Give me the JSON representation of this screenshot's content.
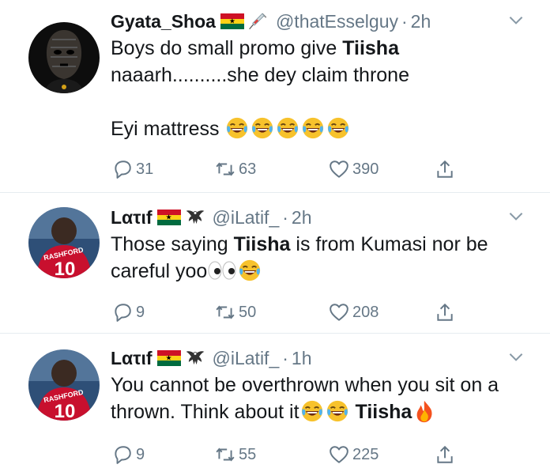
{
  "tweets": [
    {
      "display_name": "Gyata_Shoa",
      "handle": "@thatEsselguy",
      "time": "2h",
      "text_a": "Boys do small promo give ",
      "text_bold": "Tiisha",
      "text_b": " naaarh..........she dey claim throne",
      "text_c": "Eyi mattress",
      "reply_count": "31",
      "retweet_count": "63",
      "like_count": "390"
    },
    {
      "display_name": "Lατιf",
      "handle": "@iLatif_",
      "time": "2h",
      "text_a": "Those saying ",
      "text_bold": "Tiisha",
      "text_b": " is from Kumasi nor be careful yoo",
      "reply_count": "9",
      "retweet_count": "50",
      "like_count": "208"
    },
    {
      "display_name": "Lατιf",
      "handle": "@iLatif_",
      "time": "1h",
      "text_a": "You cannot be overthrown when you sit on a thrown. Think about it",
      "text_bold": "Tiisha",
      "reply_count": "9",
      "retweet_count": "55",
      "like_count": "225"
    }
  ],
  "avatar_jersey": {
    "name": "RASHFORD",
    "number": "10"
  },
  "colors": {
    "text": "#14171a",
    "muted": "#657786",
    "divider": "#e6ecf0",
    "jersey_red": "#c8102e"
  },
  "icons": {
    "reply": "reply-icon",
    "retweet": "retweet-icon",
    "like": "heart-icon",
    "share": "share-icon",
    "menu": "chevron-down-icon",
    "laugh_emoji": "face-with-tears-of-joy-emoji",
    "eyes_emoji": "eyes-emoji",
    "fire_emoji": "fire-emoji",
    "flag": "ghana-flag-emoji",
    "syringe": "syringe-emoji",
    "eagle": "eagle-icon"
  }
}
